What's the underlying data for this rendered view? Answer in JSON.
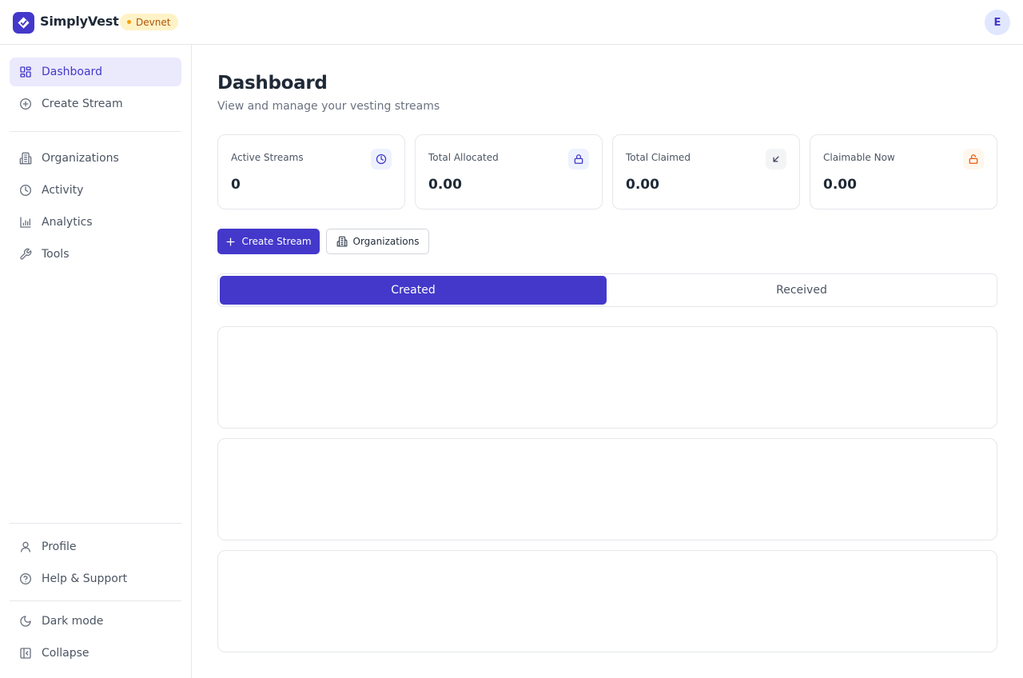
{
  "app": {
    "brand": "SimplyVest",
    "network_badge": "Devnet",
    "avatar_initial": "E"
  },
  "sidebar": {
    "primary": [
      {
        "label": "Dashboard",
        "icon": "dashboard-icon",
        "active": true
      },
      {
        "label": "Create Stream",
        "icon": "plus-circle-icon",
        "active": false
      }
    ],
    "secondary": [
      {
        "label": "Organizations",
        "icon": "building-icon"
      },
      {
        "label": "Activity",
        "icon": "clock-icon"
      },
      {
        "label": "Analytics",
        "icon": "bar-chart-icon"
      },
      {
        "label": "Tools",
        "icon": "wrench-icon"
      }
    ],
    "footer": [
      {
        "label": "Profile",
        "icon": "user-icon"
      },
      {
        "label": "Help & Support",
        "icon": "help-circle-icon"
      }
    ],
    "bottom": [
      {
        "label": "Dark mode",
        "icon": "moon-icon"
      },
      {
        "label": "Collapse",
        "icon": "collapse-icon"
      }
    ]
  },
  "main": {
    "title": "Dashboard",
    "subtitle": "View and manage your vesting streams",
    "stats": [
      {
        "label": "Active Streams",
        "value": "0",
        "icon": "clock-icon",
        "icon_color": "#4338ca",
        "icon_bg": "#eef2ff"
      },
      {
        "label": "Total Allocated",
        "value": "0.00",
        "icon": "lock-icon",
        "icon_color": "#4338ca",
        "icon_bg": "#eef2ff"
      },
      {
        "label": "Total Claimed",
        "value": "0.00",
        "icon": "arrow-down-left-icon",
        "icon_color": "#374151",
        "icon_bg": "#f3f4f6"
      },
      {
        "label": "Claimable Now",
        "value": "0.00",
        "icon": "unlock-icon",
        "icon_color": "#ea580c",
        "icon_bg": "#fff7ed"
      }
    ],
    "actions": {
      "create_stream": "Create Stream",
      "organizations": "Organizations"
    },
    "tabs": [
      {
        "label": "Created",
        "active": true
      },
      {
        "label": "Received",
        "active": false
      }
    ]
  },
  "colors": {
    "accent": "#4338ca",
    "badge_bg": "#fef3c7",
    "badge_text": "#b45309"
  }
}
